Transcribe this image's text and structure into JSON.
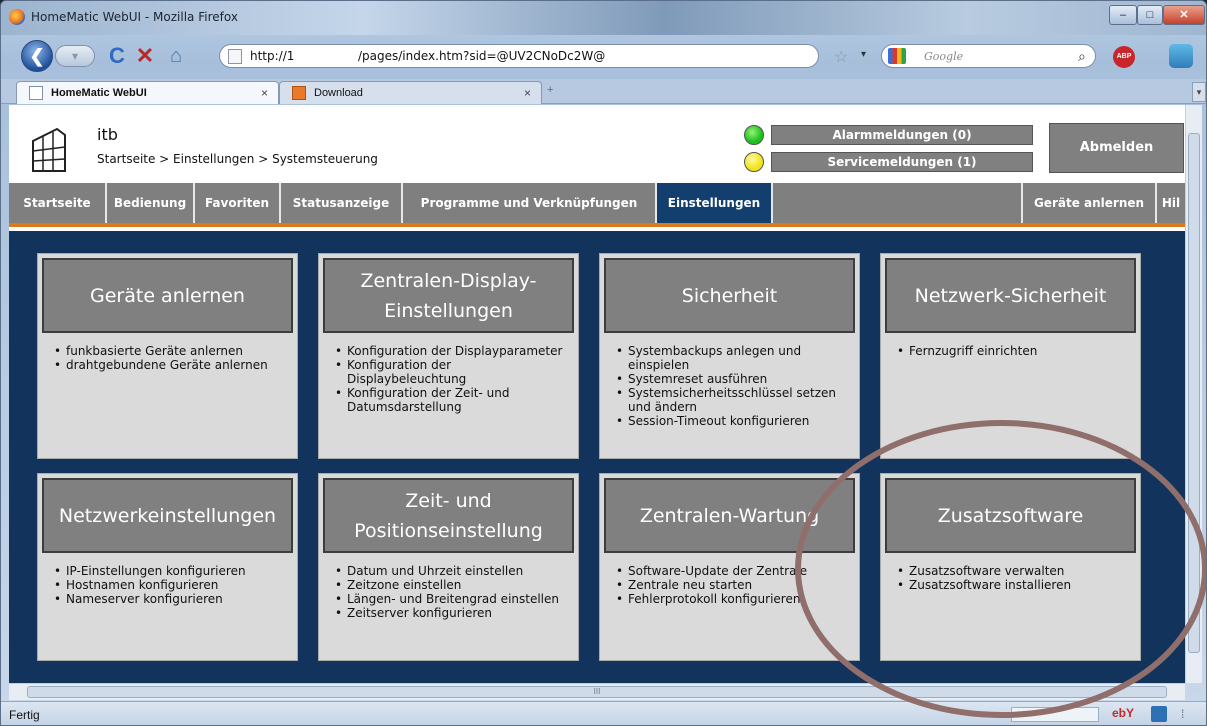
{
  "window": {
    "title": "HomeMatic WebUI - Mozilla Firefox",
    "controls": {
      "minimize": "–",
      "maximize": "□",
      "close": "✕"
    }
  },
  "toolbar": {
    "back": "❮",
    "forward": "▾",
    "reload": "C",
    "stop": "✕",
    "home": "⌂",
    "url_host": "http://1",
    "url_path": "/pages/index.htm?sid=@UV2CNoDc2W@",
    "search_placeholder": "Google",
    "search_glyph": "⌕",
    "star": "☆",
    "dropdown": "▾",
    "abp": "ABP"
  },
  "tabs": [
    {
      "label": "HomeMatic WebUI",
      "close": "×"
    },
    {
      "label": "Download",
      "close": "×"
    }
  ],
  "tab_new": "+",
  "tab_list": "▾",
  "header": {
    "site": "itb",
    "breadcrumb": "Startseite > Einstellungen > Systemsteuerung",
    "alarm_label": "Alarmmeldungen (0)",
    "service_label": "Servicemeldungen (1)",
    "logout_label": "Abmelden",
    "alarm_led_color": "#18c21a",
    "service_led_color": "#f1e21a"
  },
  "nav": {
    "items": [
      "Startseite",
      "Bedienung",
      "Favoriten",
      "Statusanzeige",
      "Programme und Verknüpfungen",
      "Einstellungen",
      "",
      "Geräte anlernen",
      "Hil"
    ],
    "active": "Einstellungen"
  },
  "cards": [
    {
      "title": "Geräte anlernen",
      "items": [
        "funkbasierte Geräte anlernen",
        "drahtgebundene Geräte anlernen"
      ]
    },
    {
      "title": "Zentralen-Display-Einstellungen",
      "items": [
        "Konfiguration der Displayparameter",
        "Konfiguration der Displaybeleuchtung",
        "Konfiguration der Zeit- und Datumsdarstellung"
      ]
    },
    {
      "title": "Sicherheit",
      "items": [
        "Systembackups anlegen und einspielen",
        "Systemreset ausführen",
        "Systemsicherheitsschlüssel setzen und ändern",
        "Session-Timeout konfigurieren"
      ]
    },
    {
      "title": "Netzwerk-Sicherheit",
      "items": [
        "Fernzugriff einrichten"
      ]
    },
    {
      "title": "Netzwerkeinstellungen",
      "items": [
        "IP-Einstellungen konfigurieren",
        "Hostnamen konfigurieren",
        "Nameserver konfigurieren"
      ]
    },
    {
      "title": "Zeit- und Positionseinstellung",
      "items": [
        "Datum und Uhrzeit einstellen",
        "Zeitzone einstellen",
        "Längen- und Breitengrad einstellen",
        "Zeitserver konfigurieren"
      ]
    },
    {
      "title": "Zentralen-Wartung",
      "items": [
        "Software-Update der Zentrale",
        "Zentrale neu starten",
        "Fehlerprotokoll konfigurieren"
      ]
    },
    {
      "title": "Zusatzsoftware",
      "items": [
        "Zusatzsoftware verwalten",
        "Zusatzsoftware installieren"
      ]
    }
  ],
  "scroll": {
    "hscroll_grip": "III"
  },
  "status": {
    "text": "Fertig",
    "ebay": "ebY",
    "grip": "⁞"
  },
  "colors": {
    "accent": "#d97a1e",
    "content_bg": "#12345c",
    "active_nav": "#123f6e",
    "card_head": "#808080"
  }
}
